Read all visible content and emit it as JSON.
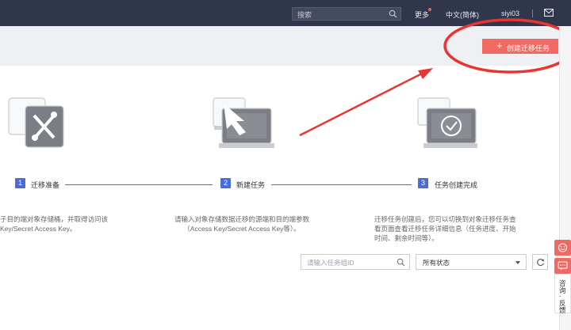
{
  "topbar": {
    "search_placeholder": "搜索",
    "more": "更多",
    "language": "中文(简体)",
    "username": "siyi03"
  },
  "actions": {
    "create_task": "创建迁移任务"
  },
  "steps": [
    {
      "number": "1",
      "label": "迁移准备",
      "desc_lines": [
        "子目的端对象存储桶，并取得访问该",
        "Key/Secret Access Key。"
      ]
    },
    {
      "number": "2",
      "label": "新建任务",
      "desc_lines": [
        "请输入对象存储数据迁移的源端和目的端参数",
        "（Access Key/Secret Access Key等）。"
      ]
    },
    {
      "number": "3",
      "label": "任务创建完成",
      "desc_lines": [
        "迁移任务创建后，您可以切换到对象迁移任务查",
        "看页面查看迁移任务详细信息（任务进度、开始",
        "时间、剩余时间等）。"
      ]
    }
  ],
  "filters": {
    "group_search_placeholder": "请输入任务组ID",
    "status_selected": "所有状态"
  },
  "sidebar_float": {
    "label_chars": [
      "咨",
      "询",
      "·",
      "反",
      "馈"
    ]
  },
  "colors": {
    "accent_red": "#f06a63",
    "step_blue": "#4a6cd4",
    "topbar": "#30364c"
  }
}
